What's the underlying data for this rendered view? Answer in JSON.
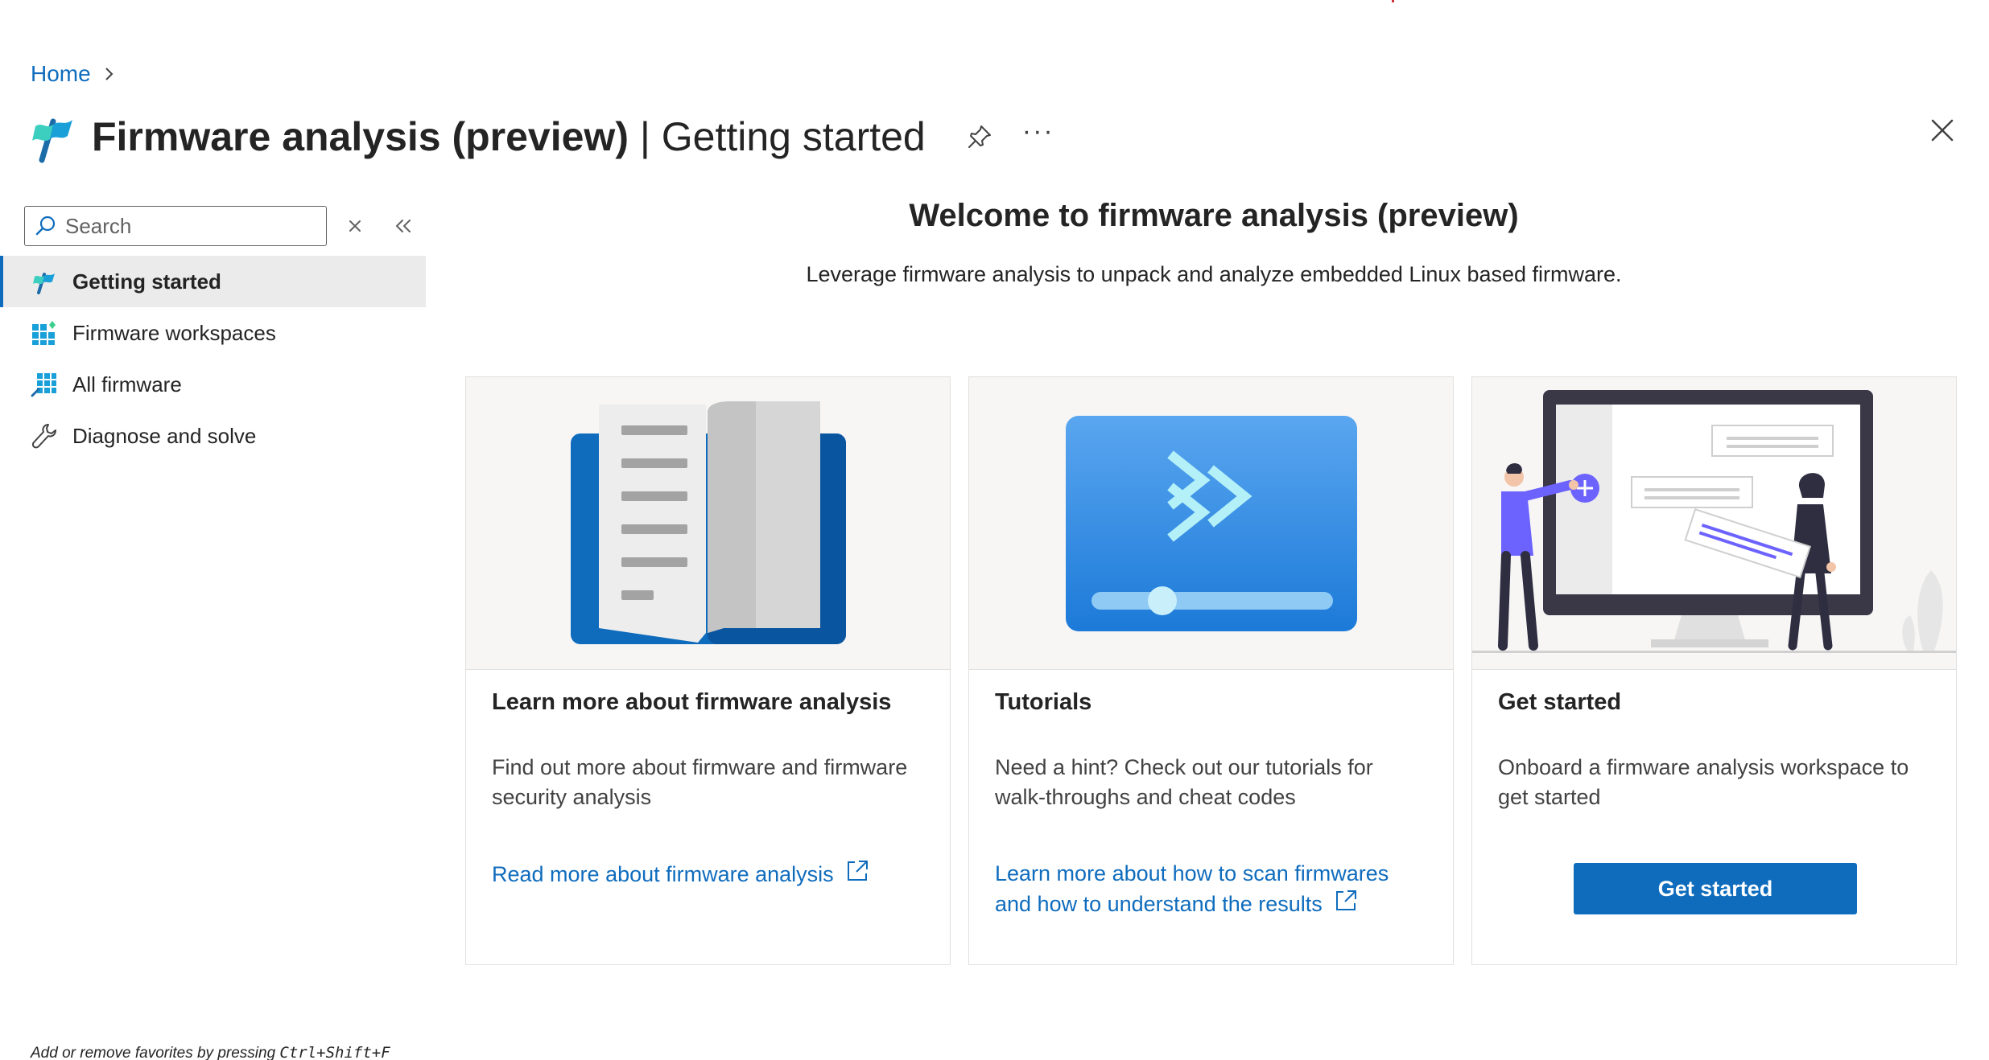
{
  "breadcrumb": {
    "home": "Home"
  },
  "header": {
    "title_main": "Firmware analysis (preview)",
    "title_sep": "|",
    "title_sub": "Getting started",
    "more": "···"
  },
  "sidebar": {
    "search_placeholder": "Search",
    "items": [
      {
        "label": "Getting started",
        "icon": "flag-icon",
        "active": true
      },
      {
        "label": "Firmware workspaces",
        "icon": "grid-icon",
        "active": false
      },
      {
        "label": "All firmware",
        "icon": "firmware-grid-icon",
        "active": false
      },
      {
        "label": "Diagnose and solve",
        "icon": "wrench-icon",
        "active": false
      }
    ],
    "footer_prefix": "Add or remove favorites by pressing ",
    "footer_shortcut": "Ctrl+Shift+F"
  },
  "main": {
    "welcome": "Welcome to firmware analysis (preview)",
    "subtitle": "Leverage firmware analysis to unpack and analyze embedded Linux based firmware.",
    "cards": [
      {
        "title": "Learn more about firmware analysis",
        "description": "Find out more about firmware and firmware security analysis",
        "link": "Read more about firmware analysis"
      },
      {
        "title": "Tutorials",
        "description": "Need a hint? Check out our tutorials for walk-throughs and cheat codes",
        "link": "Learn more about how to scan firmwares and how to understand the results"
      },
      {
        "title": "Get started",
        "description": "Onboard a firmware analysis workspace to get started",
        "button": "Get started"
      }
    ]
  },
  "colors": {
    "accent": "#0f6cbd",
    "active_bg": "#ebebeb",
    "card_img_bg": "#f7f6f5"
  }
}
